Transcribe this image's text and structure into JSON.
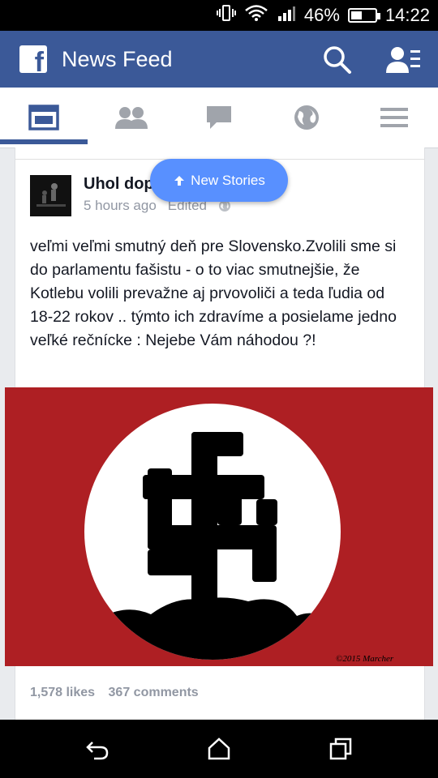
{
  "status_bar": {
    "battery": "46%",
    "time": "14:22",
    "battery_level": 0.46
  },
  "header": {
    "title": "News Feed"
  },
  "tabs": [
    {
      "name": "news-feed",
      "active": true
    },
    {
      "name": "friend-requests",
      "active": false
    },
    {
      "name": "messages",
      "active": false
    },
    {
      "name": "notifications",
      "active": false
    },
    {
      "name": "more",
      "active": false
    }
  ],
  "new_stories": {
    "label": "New Stories"
  },
  "post": {
    "author": "Uhol dop",
    "time": "5 hours ago",
    "edited": "Edited",
    "text": "veľmi veľmi smutný deň pre Slovensko.Zvolili sme si do parlamentu fašistu - o to viac smutnejšie, že  Kotlebu volili prevažne aj prvovoliči a teda ľudia od 18-22 rokov .. týmto ich zdravíme a posielame jedno veľké rečnícke : Nejebe Vám náhodou ?!",
    "image_signature": "©2015 Marcher",
    "likes": "1,578 likes",
    "comments": "367 comments"
  },
  "colors": {
    "brand": "#3b5998",
    "pill": "#5890ff",
    "flag_red": "#ae1f23"
  }
}
